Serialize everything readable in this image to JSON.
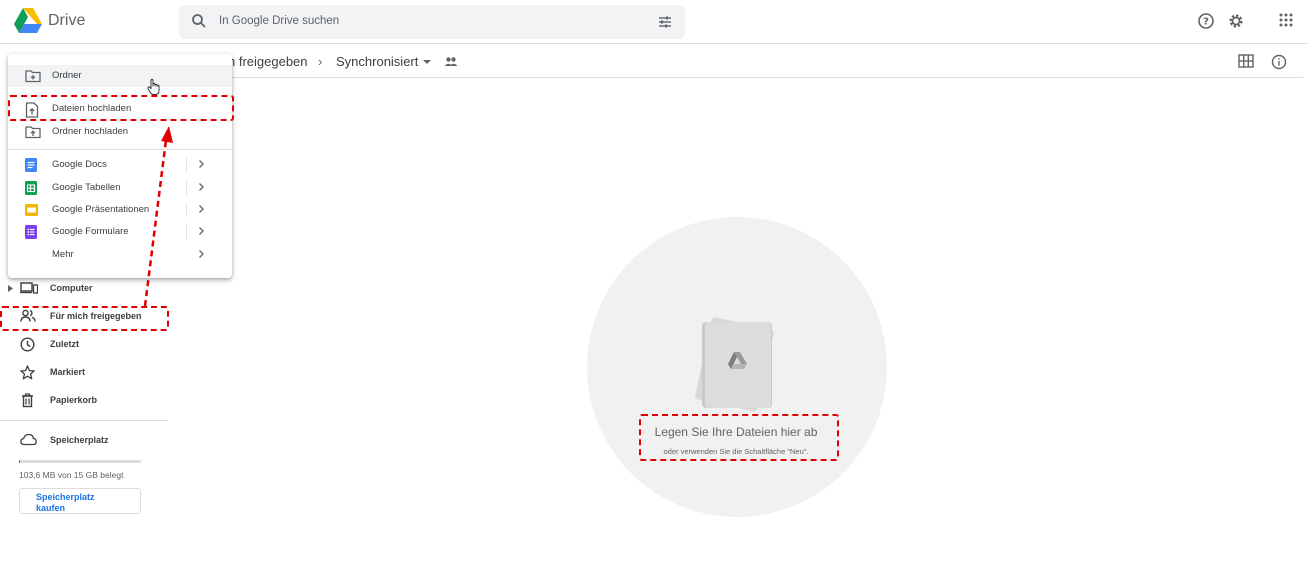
{
  "app": {
    "name": "Drive"
  },
  "search": {
    "placeholder": "In Google Drive suchen"
  },
  "breadcrumb": {
    "parent": "n freigegeben",
    "separator": "›",
    "current": "Synchronisiert"
  },
  "menu": {
    "items": [
      {
        "label": "Ordner",
        "icon": "new-folder-icon"
      },
      {
        "label": "Dateien hochladen",
        "icon": "file-upload-icon"
      },
      {
        "label": "Ordner hochladen",
        "icon": "folder-upload-icon"
      },
      {
        "label": "Google Docs",
        "icon": "google-docs-icon",
        "color": "#4285f4"
      },
      {
        "label": "Google Tabellen",
        "icon": "google-sheets-icon",
        "color": "#0f9d58"
      },
      {
        "label": "Google Präsentationen",
        "icon": "google-slides-icon",
        "color": "#f4b400"
      },
      {
        "label": "Google Formulare",
        "icon": "google-forms-icon",
        "color": "#7e3ff2"
      },
      {
        "label": "Mehr",
        "icon": ""
      }
    ]
  },
  "sidebar": {
    "items": [
      {
        "label": "Computer",
        "icon": "computer-icon"
      },
      {
        "label": "Für mich freigegeben",
        "icon": "shared-users-icon"
      },
      {
        "label": "Zuletzt",
        "icon": "clock-icon"
      },
      {
        "label": "Markiert",
        "icon": "star-icon"
      },
      {
        "label": "Papierkorb",
        "icon": "trash-icon"
      },
      {
        "label": "Speicherplatz",
        "icon": "cloud-icon"
      }
    ],
    "storage": {
      "usage": "103,6 MB von 15 GB belegt",
      "used_fraction": 0.007,
      "buy_label": "Speicherplatz kaufen"
    }
  },
  "empty_state": {
    "title": "Legen Sie Ihre Dateien hier ab",
    "subtitle": "oder verwenden Sie die Schaltfläche \"Neu\"."
  },
  "colors": {
    "accent": "#1a73e8",
    "highlight": "#e00000"
  }
}
